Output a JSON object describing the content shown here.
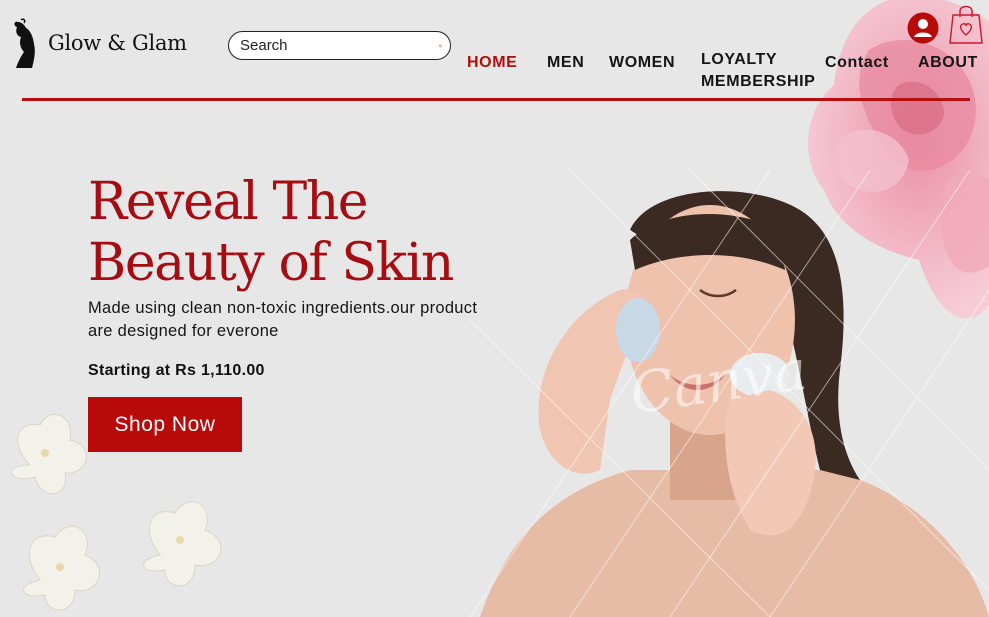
{
  "brand": {
    "name": "Glow & Glam",
    "logo_icon": "woman-silhouette-icon"
  },
  "search": {
    "placeholder": "Search",
    "icon": "search-icon"
  },
  "nav": {
    "home": "HOME",
    "men": "MEN",
    "women": "WOMEN",
    "loyalty_line1": "LOYALTY",
    "loyalty_line2": "MEMBERSHIP",
    "contact": "Contact",
    "about": "ABOUT"
  },
  "header_icons": {
    "account": "account-icon",
    "cart": "shopping-bag-heart-icon"
  },
  "hero": {
    "title_line1": "Reveal The",
    "title_line2": "Beauty of Skin",
    "subtitle_line1": "Made using clean non-toxic ingredients.our product",
    "subtitle_line2": "are designed for everone",
    "price": "Starting at Rs 1,110.00",
    "cta": "Shop Now",
    "watermark": "Canva"
  },
  "colors": {
    "accent": "#b20d0d",
    "background": "#e7e7e7",
    "text": "#151515"
  }
}
